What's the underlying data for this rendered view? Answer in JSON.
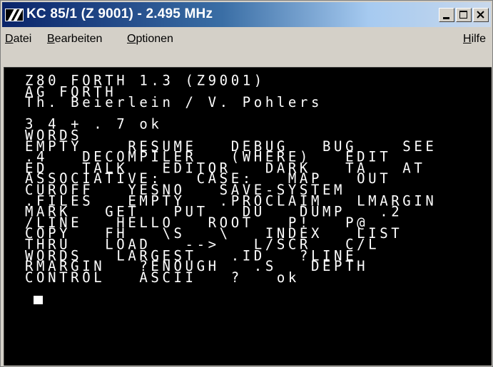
{
  "window": {
    "title": "KC 85/1  (Z 9001) - 2.495 MHz",
    "icon": "kc-app-icon",
    "controls": [
      "minimize-icon",
      "maximize-icon",
      "close-icon"
    ]
  },
  "menu": {
    "datei": {
      "accel": "D",
      "rest": "atei"
    },
    "bearbeiten": {
      "accel": "B",
      "rest": "earbeiten"
    },
    "optionen": {
      "accel": "O",
      "rest": "ptionen"
    },
    "hilfe": {
      "accel": "H",
      "rest": "ilfe"
    }
  },
  "terminal": {
    "lines": [
      "Z80 FORTH 1.3 (Z9001)",
      "AG FORTH",
      "Th. Beierlein / V. Pohlers",
      "",
      "3 4 + . 7 ok",
      "WORDS",
      "EMPTY    RESUME   DEBUG   BUG    SEE",
      ".4   DECOMPILER   (WHERE)   EDIT",
      "ED   TALK   EDITOR   DARK   TA   AT",
      "ASSOCIATIVE:   CASE:   MAP   OUT",
      "CUROFF   YESNO   SAVE-SYSTEM",
      ".FILES   EMPTY   .PROCLAIM   LMARGIN",
      "MARK   GET   PUT   DU   DUMP   .2",
      "/LINE   HELLO   ROOT   P!   P@",
      "COPY   FH   \\S   \\   INDEX   LIST",
      "THRU   LOAD   -->   L/SCR   C/L",
      "WORDS   LARGEST   .ID   ?LINE",
      "RMARGIN   ?ENOUGH   .S   DEPTH",
      "CONTROL   ASCII   ?   ok"
    ]
  }
}
